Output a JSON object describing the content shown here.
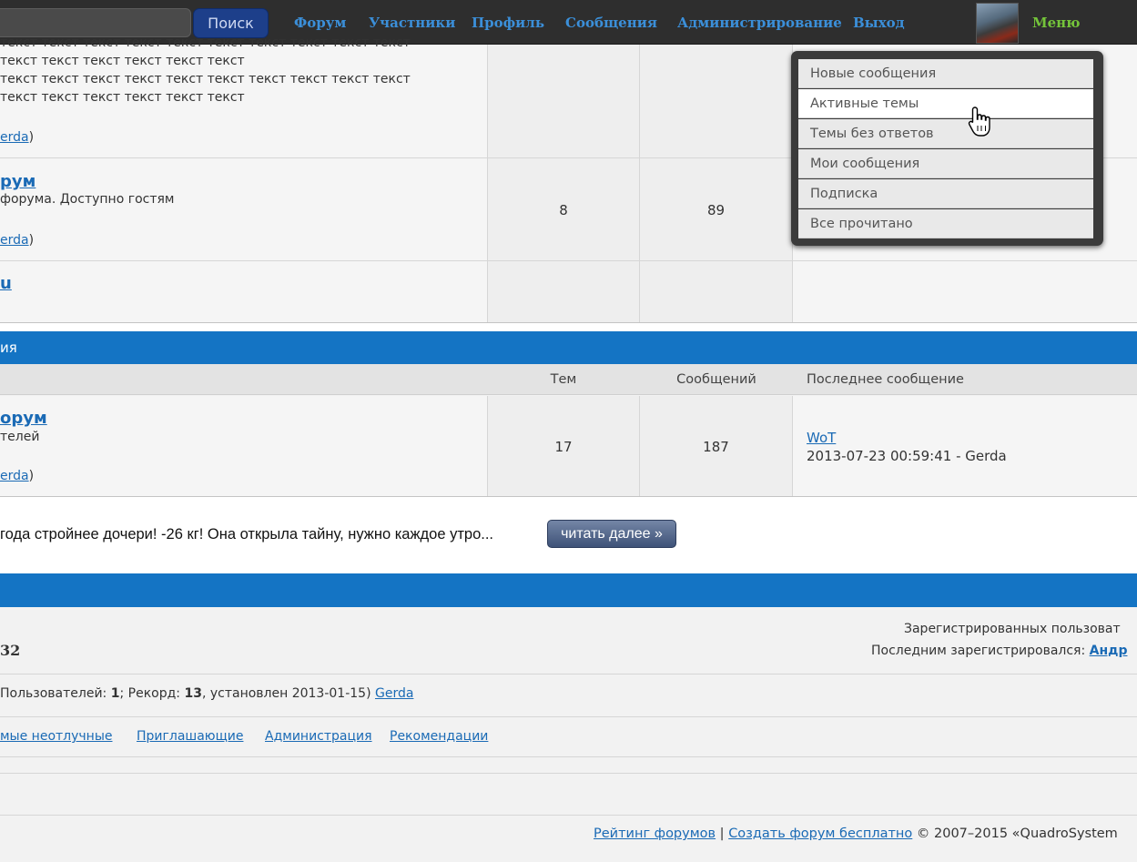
{
  "topbar": {
    "search_placeholder": "",
    "search_button": "Поиск",
    "nav": [
      "Форум",
      "Участники",
      "Профиль",
      "Сообщения",
      "Администрирование",
      "Выход"
    ],
    "menu": "Меню"
  },
  "dropdown": {
    "items": [
      "Новые сообщения",
      "Активные темы",
      "Темы без ответов",
      "Мои сообщения",
      "Подписка",
      "Все прочитано"
    ],
    "active_index": 1
  },
  "forum1": {
    "lines": [
      "текст текст текст текст текст текст текст текст текст текст",
      "текст текст текст текст текст текст",
      "текст текст текст текст текст текст текст текст текст текст",
      "текст текст текст текст текст текст"
    ],
    "mod_suffix": "erda",
    "mod_close": ")"
  },
  "forum2": {
    "title": "рум",
    "desc": "форума. Доступно гостям",
    "mod_suffix": "erda",
    "mod_close": ")",
    "topics": "8",
    "posts": "89"
  },
  "forum3": {
    "title": "u"
  },
  "section2": {
    "title": "ия",
    "col_topics": "Тем",
    "col_posts": "Сообщений",
    "col_last": "Последнее сообщение"
  },
  "forum4": {
    "title": "орум",
    "desc": "телей",
    "mod_suffix": "erda",
    "mod_close": ")",
    "topics": "17",
    "posts": "187",
    "last_topic": "WoT",
    "last_info": "2013-07-23 00:59:41 - Gerda"
  },
  "ad": {
    "text": "года стройнее дочери! -26 кг! Она открыла тайну, нужно каждое утро...",
    "button": "читать далее »"
  },
  "stats": {
    "left_number": "32",
    "registered": "Зарегистрированных пользоват",
    "last_registered_label": "Последним зарегистрировался:",
    "last_registered_user": "Андр"
  },
  "online": {
    "prefix": "Пользователей: ",
    "users": "1",
    "mid": "; Рекорд: ",
    "record": "13",
    "suffix": ", установлен 2013-01-15)",
    "user": "Gerda"
  },
  "links": [
    "мые неотлучные",
    "Приглашающие",
    "Администрация",
    "Рекомендации"
  ],
  "footer": {
    "rating": "Рейтинг форумов",
    "sep": " | ",
    "create": "Создать форум бесплатно",
    "copyright": "© 2007–2015 «QuadroSystem"
  }
}
